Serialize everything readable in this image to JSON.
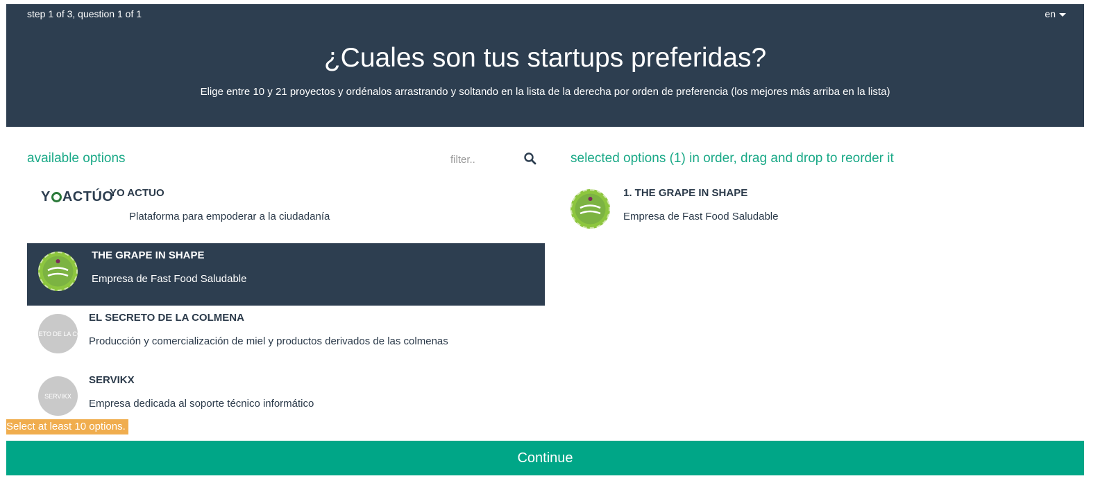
{
  "header": {
    "step_text": "step 1 of 3, question 1 of 1",
    "language": "en",
    "title": "¿Cuales son tus startups preferidas?",
    "subtitle": "Elige entre 10 y 21 proyectos y ordénalos arrastrando y soltando en la lista de la derecha por orden de preferencia (los mejores más arriba en la lista)"
  },
  "available": {
    "heading": "available options",
    "filter_placeholder": "filter..",
    "items": [
      {
        "logo_text": "YOACTÚO",
        "title": "YO ACTUO",
        "description": "Plataforma para empoderar a la ciudadanía"
      },
      {
        "logo_text": "",
        "title": "THE GRAPE IN SHAPE",
        "description": "Empresa de Fast Food Saludable",
        "highlighted": true
      },
      {
        "logo_text": "RETO DE LA CO",
        "title": "EL SECRETO DE LA COLMENA",
        "description": "Producción y comercialización de miel y productos derivados de las colmenas"
      },
      {
        "logo_text": "SERVIKX",
        "title": "SERVIKX",
        "description": "Empresa dedicada al soporte técnico informático"
      }
    ]
  },
  "selected": {
    "heading": "selected options (1) in order, drag and drop to reorder it",
    "items": [
      {
        "title": "1. THE GRAPE IN SHAPE",
        "description": "Empresa de Fast Food Saludable"
      }
    ]
  },
  "warning": "Select at least 10 options.",
  "continue_label": "Continue",
  "colors": {
    "header_bg": "#2d3e50",
    "accent": "#1aa987",
    "button_bg": "#00a687",
    "warning_bg": "#f0ad4e"
  }
}
